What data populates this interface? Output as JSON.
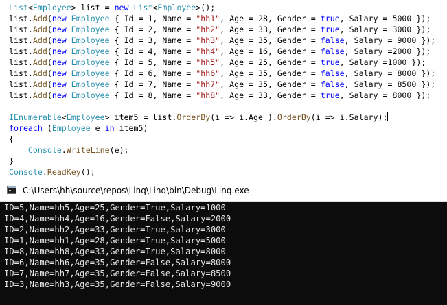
{
  "editor": {
    "lines": [
      [
        [
          "type",
          "List"
        ],
        [
          "plain",
          "<"
        ],
        [
          "type",
          "Employee"
        ],
        [
          "plain",
          "> list = "
        ],
        [
          "kw",
          "new"
        ],
        [
          "plain",
          " "
        ],
        [
          "type",
          "List"
        ],
        [
          "plain",
          "<"
        ],
        [
          "type",
          "Employee"
        ],
        [
          "plain",
          ">();"
        ]
      ],
      [
        [
          "plain",
          "list."
        ],
        [
          "method",
          "Add"
        ],
        [
          "plain",
          "("
        ],
        [
          "kw",
          "new"
        ],
        [
          "plain",
          " "
        ],
        [
          "type",
          "Employee"
        ],
        [
          "plain",
          " { Id = 1, Name = "
        ],
        [
          "str",
          "\"hh1\""
        ],
        [
          "plain",
          ", Age = 28, Gender = "
        ],
        [
          "kw",
          "true"
        ],
        [
          "plain",
          ", Salary = 5000 });"
        ]
      ],
      [
        [
          "plain",
          "list."
        ],
        [
          "method",
          "Add"
        ],
        [
          "plain",
          "("
        ],
        [
          "kw",
          "new"
        ],
        [
          "plain",
          " "
        ],
        [
          "type",
          "Employee"
        ],
        [
          "plain",
          " { Id = 2, Name = "
        ],
        [
          "str",
          "\"hh2\""
        ],
        [
          "plain",
          ", Age = 33, Gender = "
        ],
        [
          "kw",
          "true"
        ],
        [
          "plain",
          ", Salary = 3000 });"
        ]
      ],
      [
        [
          "plain",
          "list."
        ],
        [
          "method",
          "Add"
        ],
        [
          "plain",
          "("
        ],
        [
          "kw",
          "new"
        ],
        [
          "plain",
          " "
        ],
        [
          "type",
          "Employee"
        ],
        [
          "plain",
          " { Id = 3, Name = "
        ],
        [
          "str",
          "\"hh3\""
        ],
        [
          "plain",
          ", Age = 35, Gender = "
        ],
        [
          "kw",
          "false"
        ],
        [
          "plain",
          ", Salary = 9000 });"
        ]
      ],
      [
        [
          "plain",
          "list."
        ],
        [
          "method",
          "Add"
        ],
        [
          "plain",
          "("
        ],
        [
          "kw",
          "new"
        ],
        [
          "plain",
          " "
        ],
        [
          "type",
          "Employee"
        ],
        [
          "plain",
          " { Id = 4, Name = "
        ],
        [
          "str",
          "\"hh4\""
        ],
        [
          "plain",
          ", Age = 16, Gender = "
        ],
        [
          "kw",
          "false"
        ],
        [
          "plain",
          ", Salary =2000 });"
        ]
      ],
      [
        [
          "plain",
          "list."
        ],
        [
          "method",
          "Add"
        ],
        [
          "plain",
          "("
        ],
        [
          "kw",
          "new"
        ],
        [
          "plain",
          " "
        ],
        [
          "type",
          "Employee"
        ],
        [
          "plain",
          " { Id = 5, Name = "
        ],
        [
          "str",
          "\"hh5\""
        ],
        [
          "plain",
          ", Age = 25, Gender = "
        ],
        [
          "kw",
          "true"
        ],
        [
          "plain",
          ", Salary =1000 });"
        ]
      ],
      [
        [
          "plain",
          "list."
        ],
        [
          "method",
          "Add"
        ],
        [
          "plain",
          "("
        ],
        [
          "kw",
          "new"
        ],
        [
          "plain",
          " "
        ],
        [
          "type",
          "Employee"
        ],
        [
          "plain",
          " { Id = 6, Name = "
        ],
        [
          "str",
          "\"hh6\""
        ],
        [
          "plain",
          ", Age = 35, Gender = "
        ],
        [
          "kw",
          "false"
        ],
        [
          "plain",
          ", Salary = 8000 });"
        ]
      ],
      [
        [
          "plain",
          "list."
        ],
        [
          "method",
          "Add"
        ],
        [
          "plain",
          "("
        ],
        [
          "kw",
          "new"
        ],
        [
          "plain",
          " "
        ],
        [
          "type",
          "Employee"
        ],
        [
          "plain",
          " { Id = 7, Name = "
        ],
        [
          "str",
          "\"hh7\""
        ],
        [
          "plain",
          ", Age = 35, Gender = "
        ],
        [
          "kw",
          "false"
        ],
        [
          "plain",
          ", Salary = 8500 });"
        ]
      ],
      [
        [
          "plain",
          "list."
        ],
        [
          "method",
          "Add"
        ],
        [
          "plain",
          "("
        ],
        [
          "kw",
          "new"
        ],
        [
          "plain",
          " "
        ],
        [
          "type",
          "Employee"
        ],
        [
          "plain",
          " { Id = 8, Name = "
        ],
        [
          "str",
          "\"hh8\""
        ],
        [
          "plain",
          ", Age = 33, Gender = "
        ],
        [
          "kw",
          "true"
        ],
        [
          "plain",
          ", Salary = 8000 });"
        ]
      ],
      [],
      [
        [
          "type",
          "IEnumerable"
        ],
        [
          "plain",
          "<"
        ],
        [
          "type",
          "Employee"
        ],
        [
          "plain",
          "> item5 = list."
        ],
        [
          "method",
          "OrderBy"
        ],
        [
          "plain",
          "(i => i.Age )."
        ],
        [
          "method",
          "OrderBy"
        ],
        [
          "plain",
          "(i => i.Salary);"
        ],
        [
          "cursor",
          ""
        ]
      ],
      [
        [
          "kw",
          "foreach"
        ],
        [
          "plain",
          " ("
        ],
        [
          "type",
          "Employee"
        ],
        [
          "plain",
          " e "
        ],
        [
          "kw",
          "in"
        ],
        [
          "plain",
          " item5)"
        ]
      ],
      [
        [
          "plain",
          "{"
        ]
      ],
      [
        [
          "plain",
          "    "
        ],
        [
          "type",
          "Console"
        ],
        [
          "plain",
          "."
        ],
        [
          "method",
          "WriteLine"
        ],
        [
          "plain",
          "(e);"
        ]
      ],
      [
        [
          "plain",
          "}"
        ]
      ],
      [
        [
          "type",
          "Console"
        ],
        [
          "plain",
          "."
        ],
        [
          "method",
          "ReadKey"
        ],
        [
          "plain",
          "();"
        ]
      ]
    ]
  },
  "console": {
    "title": "C:\\Users\\hh\\source\\repos\\Linq\\Linq\\bin\\Debug\\Linq.exe",
    "lines": [
      "ID=5,Name=hh5,Age=25,Gender=True,Salary=1000",
      "ID=4,Name=hh4,Age=16,Gender=False,Salary=2000",
      "ID=2,Name=hh2,Age=33,Gender=True,Salary=3000",
      "ID=1,Name=hh1,Age=28,Gender=True,Salary=5000",
      "ID=8,Name=hh8,Age=33,Gender=True,Salary=8000",
      "ID=6,Name=hh6,Age=35,Gender=False,Salary=8000",
      "ID=7,Name=hh7,Age=35,Gender=False,Salary=8500",
      "ID=3,Name=hh3,Age=35,Gender=False,Salary=9000"
    ]
  }
}
